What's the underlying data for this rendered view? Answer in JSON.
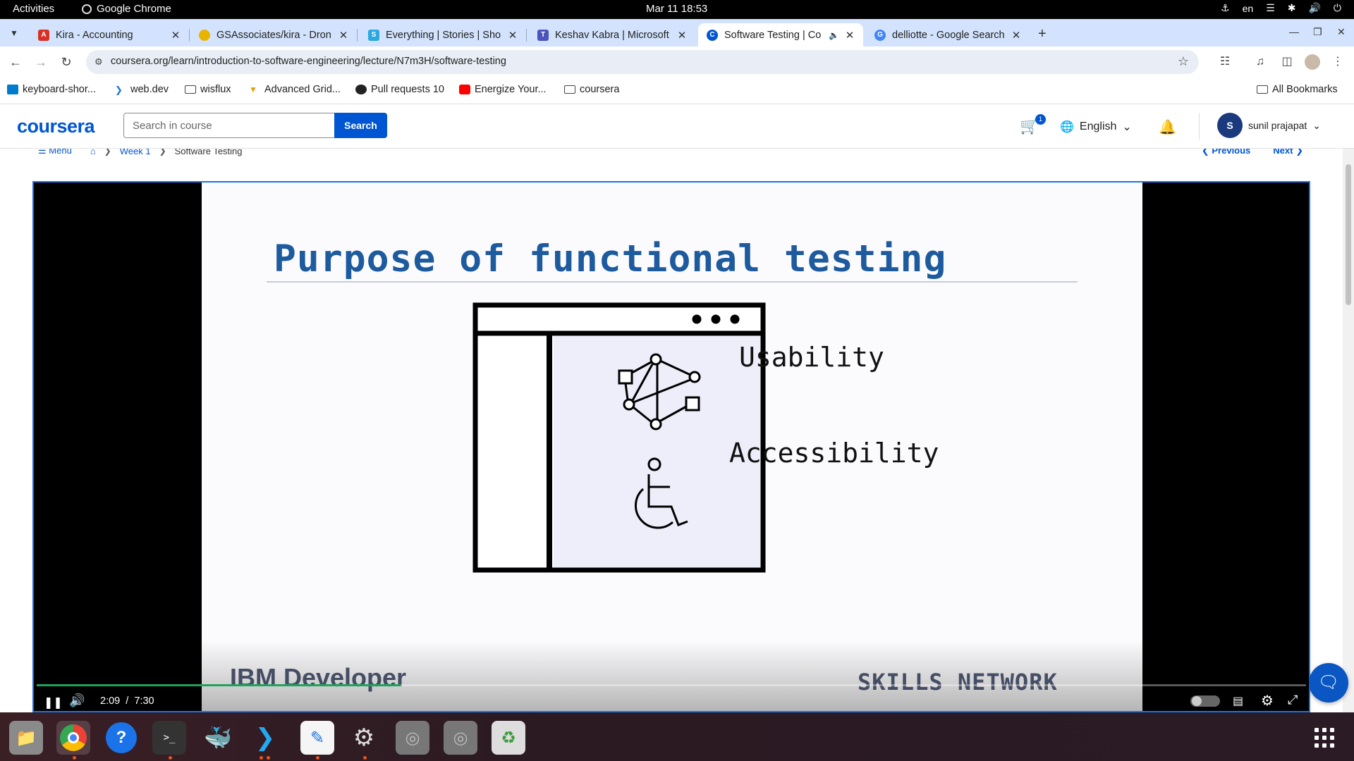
{
  "system": {
    "activities": "Activities",
    "app_name": "Google Chrome",
    "clock": "Mar 11  18:53",
    "keyboard_layout": "en"
  },
  "tabs": [
    {
      "title": "Kira - Accounting",
      "favicon_color": "#d93025",
      "favicon_glyph": "A"
    },
    {
      "title": "GSAssociates/kira - Dron",
      "favicon_color": "#e8b400",
      "favicon_glyph": ""
    },
    {
      "title": "Everything | Stories | Sho",
      "favicon_color": "#2aa8e0",
      "favicon_glyph": "S"
    },
    {
      "title": "Keshav Kabra | Microsoft",
      "favicon_color": "#4b53bc",
      "favicon_glyph": "T"
    },
    {
      "title": "Software Testing | Co",
      "favicon_color": "#0056d2",
      "favicon_glyph": "C",
      "active": true
    },
    {
      "title": "delliotte - Google Search",
      "favicon_color": "#4285f4",
      "favicon_glyph": "G"
    }
  ],
  "toolbar": {
    "url": "coursera.org/learn/introduction-to-software-engineering/lecture/N7m3H/software-testing"
  },
  "bookmarks": [
    {
      "label": "keyboard-shor...",
      "icon": "vscode-icon"
    },
    {
      "label": "web.dev",
      "icon": "webdev-icon"
    },
    {
      "label": "wisflux",
      "icon": "folder-icon"
    },
    {
      "label": "Advanced Grid...",
      "icon": "grid-icon"
    },
    {
      "label": "Pull requests 10",
      "icon": "github-icon"
    },
    {
      "label": "Energize Your...",
      "icon": "youtube-icon"
    },
    {
      "label": "coursera",
      "icon": "folder-icon"
    }
  ],
  "bookmarks_all": "All Bookmarks",
  "header": {
    "logo": "coursera",
    "search_placeholder": "Search in course",
    "search_button": "Search",
    "cart_count": "1",
    "language": "English",
    "user_initial": "S",
    "user_name": "sunil prajapat"
  },
  "breadcrumb": {
    "menu": "Menu",
    "week": "Week 1",
    "current": "Software Testing",
    "previous": "Previous",
    "next": "Next"
  },
  "slide": {
    "title": "Purpose of functional testing",
    "label_1": "Usability",
    "label_2": "Accessibility",
    "brand_left": "IBM Developer",
    "brand_right": "SKILLS NETWORK"
  },
  "player": {
    "current_time": "2:09",
    "separator": "/",
    "duration": "7:30",
    "progress_fraction": 0.2867
  },
  "colors": {
    "brand_blue": "#0056d2",
    "slide_title": "#1d5a9e",
    "progress_green": "#1fa35c"
  }
}
